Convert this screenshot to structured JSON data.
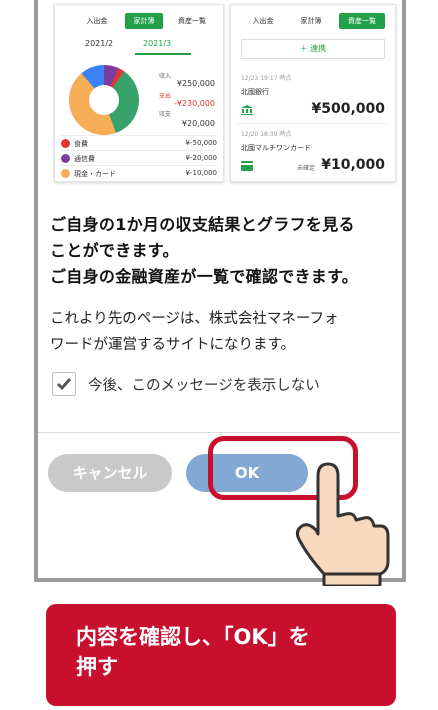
{
  "preview_left": {
    "tabs": [
      "入出金",
      "家計簿",
      "資産一覧"
    ],
    "active_tab": "家計簿",
    "months": [
      "2021/2",
      "2021/3"
    ],
    "selected_month": "2021/3",
    "summary": [
      {
        "label": "収入",
        "value": "¥250,000"
      },
      {
        "label": "支出",
        "value": "-¥230,000"
      },
      {
        "label": "収支",
        "value": "¥20,000"
      }
    ],
    "categories": [
      {
        "name": "食費",
        "amount": "¥-50,000",
        "color": "#e3342f"
      },
      {
        "name": "通信費",
        "amount": "¥-20,000",
        "color": "#7b3ea0"
      },
      {
        "name": "現金・カード",
        "amount": "¥-10,000",
        "color": "#f6ad55"
      }
    ]
  },
  "preview_right": {
    "tabs": [
      "入出金",
      "家計簿",
      "資産一覧"
    ],
    "active_tab": "資産一覧",
    "add_label": "＋ 連携",
    "accounts": [
      {
        "updated": "12/23 19:17 時点",
        "name": "北國銀行",
        "balance": "¥500,000",
        "sub": ""
      },
      {
        "updated": "12/20 18:39 時点",
        "name": "北國マルチワンカード",
        "balance": "¥10,000",
        "sub": "未確定"
      }
    ]
  },
  "message": {
    "bold_line1": "ご自身の1か月の収支結果とグラフを見る",
    "bold_line2": "ことができます。",
    "bold_line3": "ご自身の金融資産が一覧で確認できます。",
    "body_line1": "これより先のページは、株式会社マネーフォ",
    "body_line2": "ワードが運営するサイトになります。"
  },
  "checkbox_label": "今後、このメッセージを表示しない",
  "buttons": {
    "cancel": "キャンセル",
    "ok": "OK"
  },
  "caption": {
    "line1": "内容を確認し、「OK」を",
    "line2": "押す"
  }
}
